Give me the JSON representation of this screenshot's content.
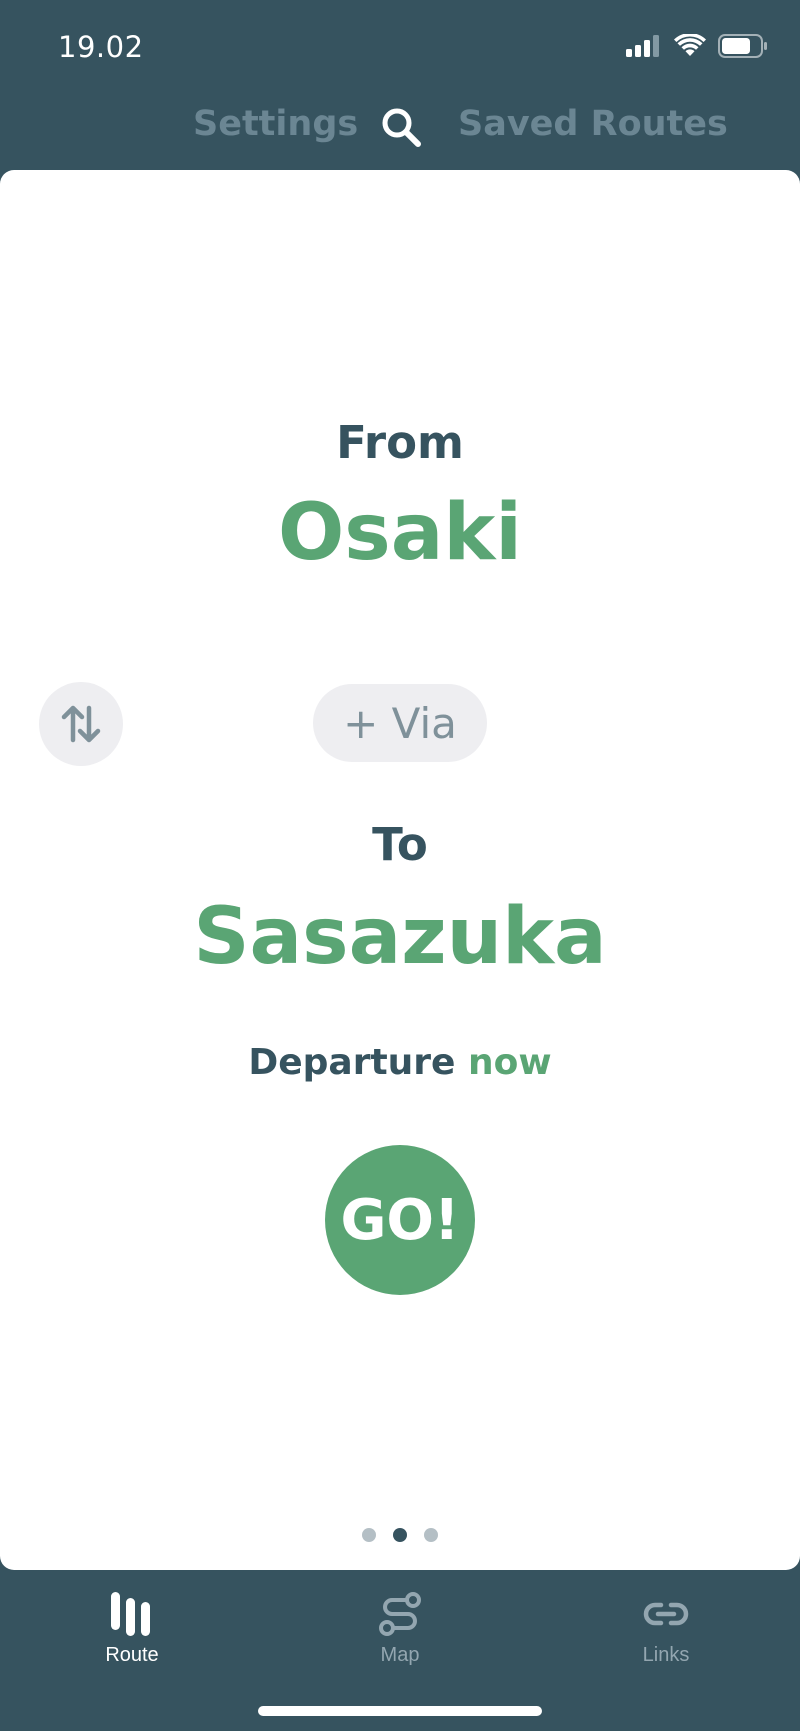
{
  "status_bar": {
    "time": "19.02"
  },
  "topnav": {
    "settings_label": "Settings",
    "saved_routes_label": "Saved Routes"
  },
  "route": {
    "from_label": "From",
    "from_station": "Osaki",
    "via_label": "+ Via",
    "to_label": "To",
    "to_station": "Sasazuka",
    "departure_label": "Departure",
    "departure_value": "now",
    "go_label": "GO!"
  },
  "pager": {
    "total": 3,
    "active_index": 1
  },
  "tabbar": {
    "tabs": [
      {
        "label": "Route",
        "icon": "route-icon",
        "active": true
      },
      {
        "label": "Map",
        "icon": "map-icon",
        "active": false
      },
      {
        "label": "Links",
        "icon": "link-icon",
        "active": false
      }
    ]
  },
  "colors": {
    "header_bg": "#36535f",
    "accent_green": "#5aa574",
    "nav_inactive": "#6b8693",
    "chip_bg": "#eeeef1"
  }
}
